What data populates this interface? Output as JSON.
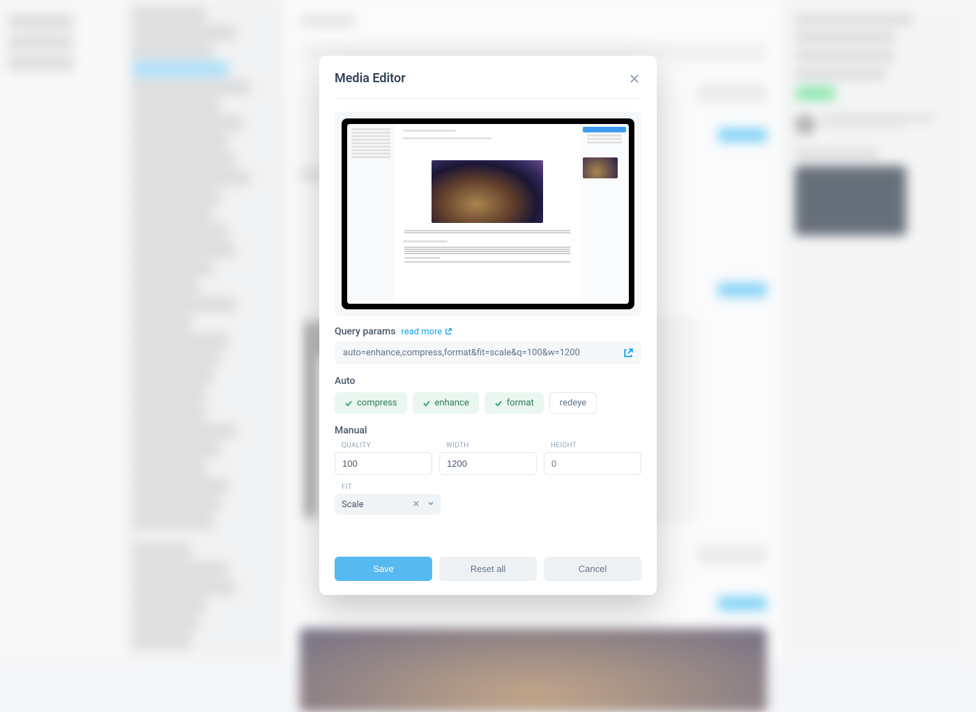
{
  "modal": {
    "title": "Media Editor",
    "query_params": {
      "label": "Query params",
      "read_more": "read more",
      "value": "auto=enhance,compress,format&fit=scale&q=100&w=1200"
    },
    "auto": {
      "label": "Auto",
      "options": [
        {
          "label": "compress",
          "active": true
        },
        {
          "label": "enhance",
          "active": true
        },
        {
          "label": "format",
          "active": true
        },
        {
          "label": "redeye",
          "active": false
        }
      ]
    },
    "manual": {
      "label": "Manual",
      "quality": {
        "label": "QUALITY",
        "value": "100"
      },
      "width": {
        "label": "WIDTH",
        "value": "1200"
      },
      "height": {
        "label": "HEIGHT",
        "value": "",
        "placeholder": "0"
      },
      "fit": {
        "label": "FIT",
        "value": "Scale"
      }
    },
    "buttons": {
      "save": "Save",
      "reset": "Reset all",
      "cancel": "Cancel"
    }
  }
}
